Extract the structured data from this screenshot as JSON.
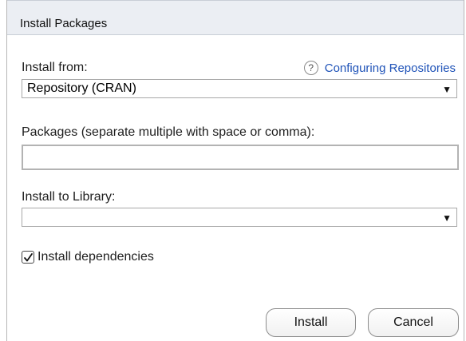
{
  "dialog": {
    "title": "Install Packages"
  },
  "install_from": {
    "label": "Install from:",
    "help_link": "Configuring Repositories",
    "help_icon": "?",
    "selected": "Repository (CRAN)",
    "arrow": "▼"
  },
  "packages": {
    "label": "Packages (separate multiple with space or comma):",
    "value": ""
  },
  "library": {
    "label": "Install to Library:",
    "selected": "",
    "arrow": "▼"
  },
  "dependencies": {
    "label": "Install dependencies",
    "checked": true
  },
  "buttons": {
    "install": "Install",
    "cancel": "Cancel"
  }
}
